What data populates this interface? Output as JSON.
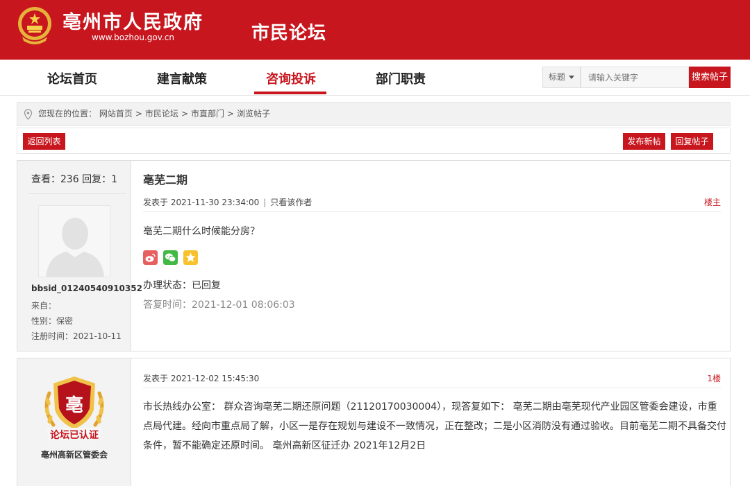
{
  "header": {
    "site_title": "亳州市人民政府",
    "site_url": "www.bozhou.gov.cn",
    "forum_title": "市民论坛"
  },
  "nav": {
    "items": [
      "论坛首页",
      "建言献策",
      "咨询投诉",
      "部门职责"
    ],
    "active": "咨询投诉",
    "search_type": "标题",
    "search_placeholder": "请输入关键字",
    "search_button": "搜索帖子"
  },
  "breadcrumb": {
    "prefix": "您现在的位置：",
    "items": [
      "网站首页",
      "市民论坛",
      "市直部门",
      "浏览帖子"
    ],
    "separator": ">"
  },
  "actions": {
    "back": "返回列表",
    "new_post": "发布新帖",
    "reply": "回复帖子"
  },
  "thread": {
    "stats": "查看：236 回复：1",
    "title": "亳芜二期",
    "author": {
      "name": "bbsid_01240540910352",
      "from": "来自：",
      "gender": "性别：保密",
      "registered": "注册时间：2021-10-11"
    },
    "post_time": "发表于 2021-11-30 23:34:00",
    "only_author": "只看该作者",
    "floor": "楼主",
    "body": "亳芜二期什么时候能分房？",
    "share_icons": [
      "weibo-icon",
      "wechat-icon",
      "qzone-icon"
    ],
    "status": "办理状态：已回复",
    "reply_time": "答复时间：2021-12-01 08:06:03"
  },
  "reply": {
    "badge_text": "论坛已认证",
    "department": "亳州高新区管委会",
    "post_time": "发表于 2021-12-02 15:45:30",
    "floor": "1楼",
    "body": "市长热线办公室： 群众咨询亳芜二期还原问题（21120170030004），现答复如下： 亳芜二期由亳芜现代产业园区管委会建设，市重点局代建。经向市重点局了解，小区一是存在规划与建设不一致情况，正在整改；二是小区消防没有通过验收。目前亳芜二期不具备交付条件，暂不能确定还原时间。 亳州高新区征迁办 2021年12月2日"
  },
  "colors": {
    "brand_red": "#c8161e",
    "side_bg": "#f3f3f3",
    "muted_text": "#888888"
  }
}
